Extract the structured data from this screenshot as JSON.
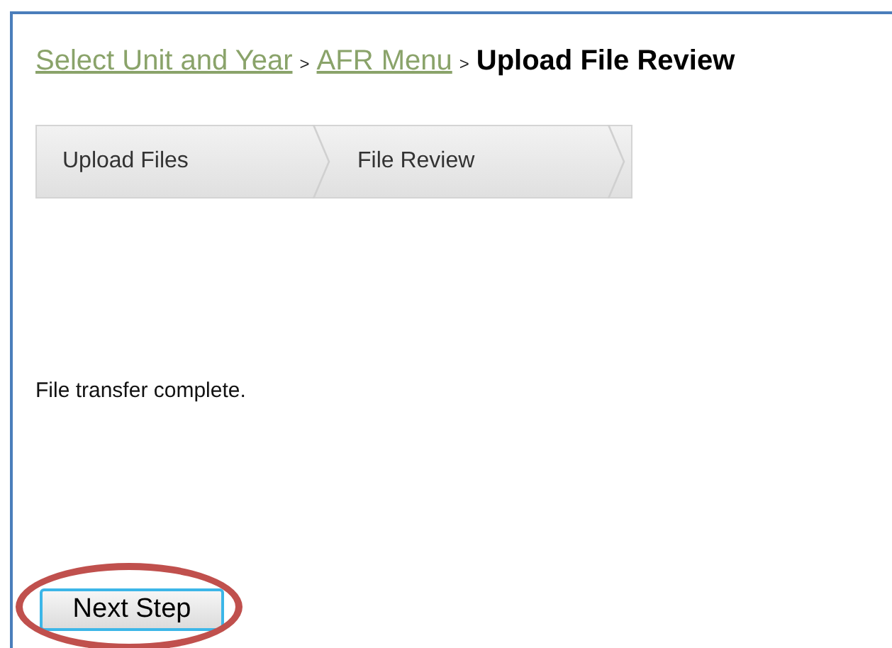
{
  "breadcrumb": {
    "links": [
      "Select Unit and Year",
      "AFR Menu"
    ],
    "separators": [
      ">",
      ">"
    ],
    "current": "Upload File Review"
  },
  "steps": [
    "Upload Files",
    "File Review"
  ],
  "message": "File transfer complete.",
  "button": "Next Step",
  "annotation": {
    "kind": "ellipse",
    "color": "#c0504d"
  }
}
